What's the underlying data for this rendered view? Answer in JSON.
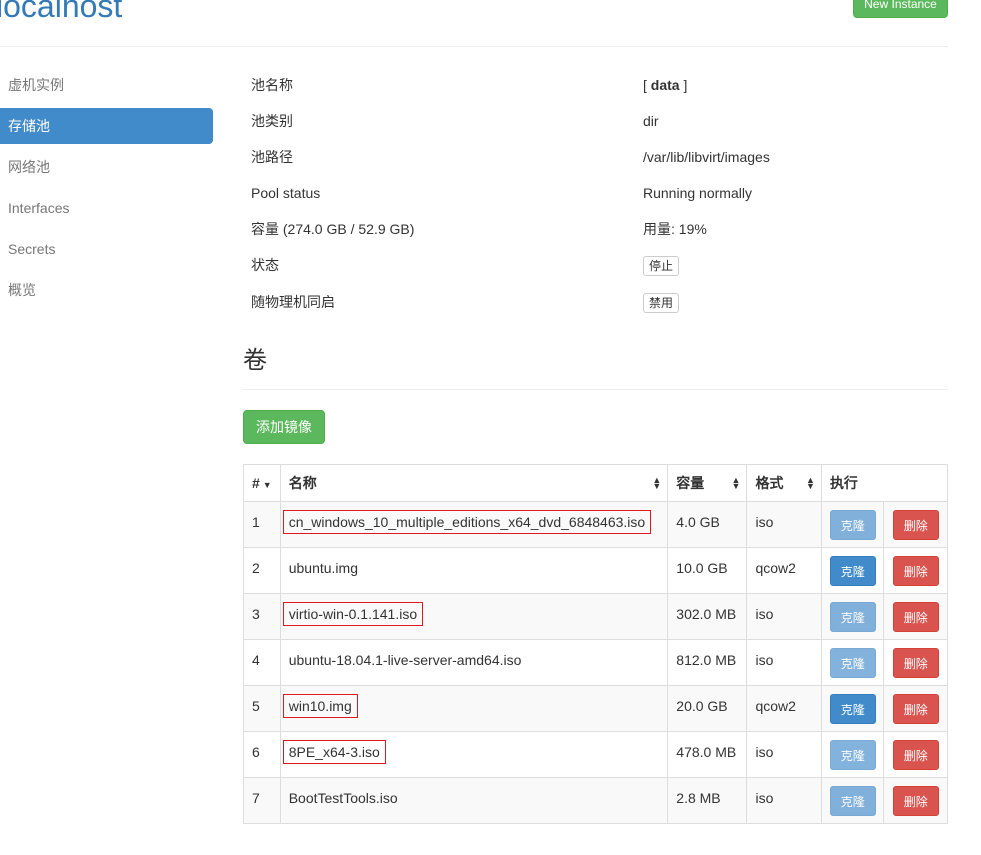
{
  "header": {
    "title": "localhost",
    "new_instance_label": "New Instance"
  },
  "sidebar": {
    "items": [
      {
        "label": "虚机实例",
        "active": false
      },
      {
        "label": "存储池",
        "active": true
      },
      {
        "label": "网络池",
        "active": false
      },
      {
        "label": "Interfaces",
        "active": false
      },
      {
        "label": "Secrets",
        "active": false
      },
      {
        "label": "概览",
        "active": false
      }
    ]
  },
  "pool": {
    "name_label": "池名称",
    "name_prefix": "[ ",
    "name_value": "data",
    "name_suffix": " ]",
    "type_label": "池类别",
    "type_value": "dir",
    "path_label": "池路径",
    "path_value": "/var/lib/libvirt/images",
    "status_label": "Pool status",
    "status_value": "Running normally",
    "capacity_label": "容量 (274.0 GB / 52.9 GB)",
    "usage_value": "用量: 19%",
    "state_label": "状态",
    "stop_button": "停止",
    "autostart_label": "随物理机同启",
    "disable_button": "禁用"
  },
  "volumes": {
    "title": "卷",
    "add_image_button": "添加镜像",
    "columns": {
      "num": "#",
      "name": "名称",
      "size": "容量",
      "format": "格式",
      "action": "执行"
    },
    "clone_label": "克隆",
    "delete_label": "删除",
    "rows": [
      {
        "num": "1",
        "name": "cn_windows_10_multiple_editions_x64_dvd_6848463.iso",
        "size": "4.0 GB",
        "format": "iso",
        "highlighted": true,
        "clone_enabled": false
      },
      {
        "num": "2",
        "name": "ubuntu.img",
        "size": "10.0 GB",
        "format": "qcow2",
        "highlighted": false,
        "clone_enabled": true
      },
      {
        "num": "3",
        "name": "virtio-win-0.1.141.iso",
        "size": "302.0 MB",
        "format": "iso",
        "highlighted": true,
        "clone_enabled": false
      },
      {
        "num": "4",
        "name": "ubuntu-18.04.1-live-server-amd64.iso",
        "size": "812.0 MB",
        "format": "iso",
        "highlighted": false,
        "clone_enabled": false
      },
      {
        "num": "5",
        "name": "win10.img",
        "size": "20.0 GB",
        "format": "qcow2",
        "highlighted": true,
        "clone_enabled": true
      },
      {
        "num": "6",
        "name": "8PE_x64-3.iso",
        "size": "478.0 MB",
        "format": "iso",
        "highlighted": true,
        "clone_enabled": false
      },
      {
        "num": "7",
        "name": "BootTestTools.iso",
        "size": "2.8 MB",
        "format": "iso",
        "highlighted": false,
        "clone_enabled": false
      }
    ]
  },
  "colors": {
    "primary": "#428bca",
    "success": "#5cb85c",
    "danger": "#d9534f",
    "highlight_box": "#e0191c"
  }
}
